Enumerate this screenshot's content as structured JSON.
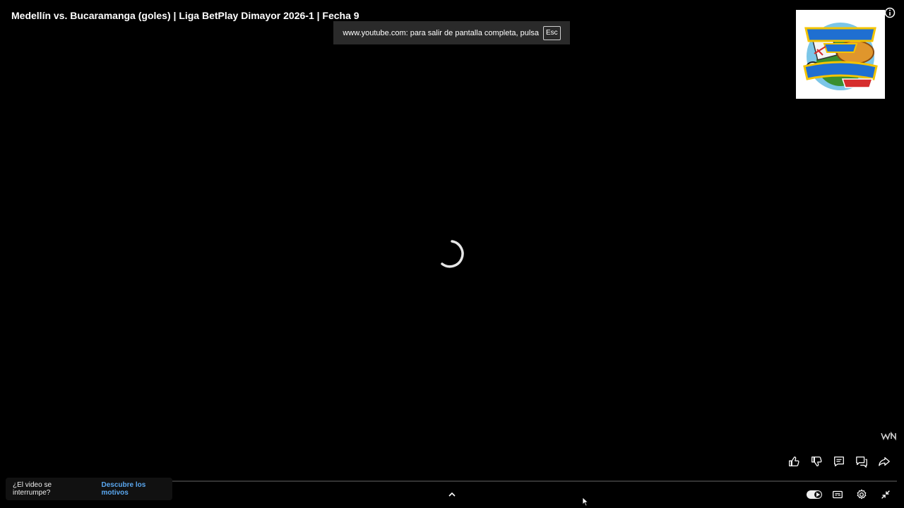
{
  "video": {
    "title": "Medellín vs. Bucaramanga (goles) | Liga BetPlay Dimayor 2026-1 | Fecha 9"
  },
  "fullscreen_toast": {
    "message": "www.youtube.com: para salir de pantalla completa, pulsa",
    "key": "Esc"
  },
  "watermark": {
    "alt": "TÁCTICA Y EMPANADA WIN"
  },
  "interruption": {
    "question": "¿El video se interrumpe?",
    "link": "Descubre los motivos"
  },
  "player": {
    "state": "loading",
    "icons": [
      "like-icon",
      "dislike-icon",
      "comments-icon",
      "chat-icon",
      "share-icon",
      "chevron-up-icon",
      "autoplay-toggle",
      "subtitles-icon",
      "settings-icon",
      "exit-fullscreen-icon",
      "info-icon",
      "loading-spinner",
      "win-logo"
    ]
  },
  "colors": {
    "background": "#000000",
    "link": "#5aa7ef",
    "toast_bg": "#2a2a2a"
  }
}
